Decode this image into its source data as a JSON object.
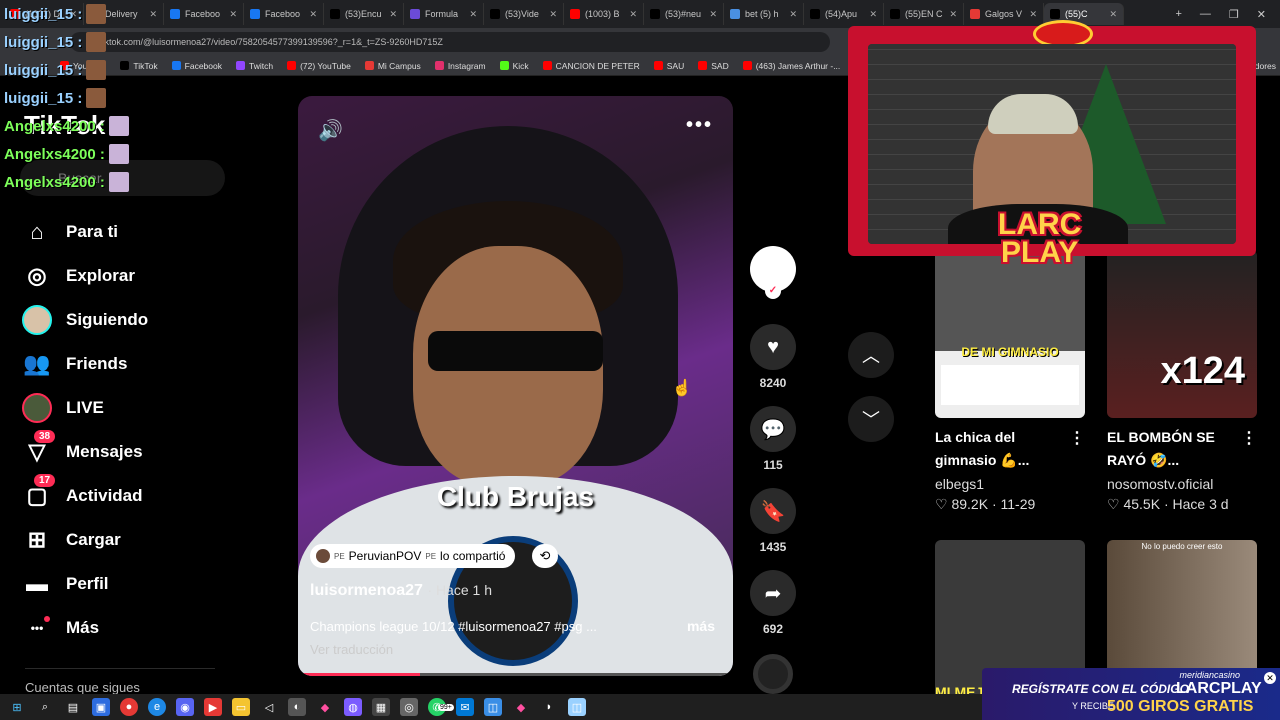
{
  "browser": {
    "tabs": [
      {
        "label": "(1003) D",
        "color": "#ff0000"
      },
      {
        "label": "Delivery",
        "color": "#3b82f6"
      },
      {
        "label": "Faceboo",
        "color": "#1877f2"
      },
      {
        "label": "Faceboo",
        "color": "#1877f2"
      },
      {
        "label": "(53)Encu",
        "color": "#000000"
      },
      {
        "label": "Formula",
        "color": "#6b4bd8"
      },
      {
        "label": "(53)Vide",
        "color": "#000000"
      },
      {
        "label": "(1003) B",
        "color": "#ff0000"
      },
      {
        "label": "(53)#neu",
        "color": "#000000"
      },
      {
        "label": "bet (5) h",
        "color": "#4a90e2"
      },
      {
        "label": "(54)Apu",
        "color": "#000000"
      },
      {
        "label": "(55)EN C",
        "color": "#000000"
      },
      {
        "label": "Galgos V",
        "color": "#e53935"
      },
      {
        "label": "(55)C",
        "color": "#000000"
      }
    ],
    "url": "tiktok.com/@luisormenoa27/video/7582054577399139596?_r=1&_t=ZS-9260HD715Z",
    "bookmarks": [
      {
        "label": "YouTube",
        "color": "#ff0000"
      },
      {
        "label": "TikTok",
        "color": "#000000"
      },
      {
        "label": "Facebook",
        "color": "#1877f2"
      },
      {
        "label": "Twitch",
        "color": "#9146ff"
      },
      {
        "label": "(72) YouTube",
        "color": "#ff0000"
      },
      {
        "label": "Mi Campus",
        "color": "#e53935"
      },
      {
        "label": "Instagram",
        "color": "#e1306c"
      },
      {
        "label": "Kick",
        "color": "#53fc18"
      },
      {
        "label": "CANCION DE PETER",
        "color": "#ff0000"
      },
      {
        "label": "SAU",
        "color": "#ff0000"
      },
      {
        "label": "SAD",
        "color": "#ff0000"
      },
      {
        "label": "(463) James Arthur -...",
        "color": "#ff0000"
      },
      {
        "label": "DRAGON BALL GT",
        "color": "#ff0000"
      }
    ],
    "bookmarks_overflow": "dores"
  },
  "chat": [
    {
      "user": "luiggii_15 :",
      "color_class": "u1"
    },
    {
      "user": "luiggii_15 :",
      "color_class": "u1"
    },
    {
      "user": "luiggii_15 :",
      "color_class": "u1"
    },
    {
      "user": "luiggii_15 :",
      "color_class": "u1"
    },
    {
      "user": "Angelxs4200 :",
      "color_class": "u2"
    },
    {
      "user": "Angelxs4200 :",
      "color_class": "u2"
    },
    {
      "user": "Angelxs4200 :",
      "color_class": "u2"
    }
  ],
  "sidebar": {
    "logo": "TikTok",
    "search_placeholder": "Buscar",
    "items": [
      {
        "label": "Para ti",
        "icon": "home-icon"
      },
      {
        "label": "Explorar",
        "icon": "compass-icon"
      },
      {
        "label": "Siguiendo",
        "icon": "following-avatar-icon"
      },
      {
        "label": "Friends",
        "icon": "friends-icon"
      },
      {
        "label": "LIVE",
        "icon": "live-avatar-icon"
      },
      {
        "label": "Mensajes",
        "icon": "messages-icon",
        "badge": "38"
      },
      {
        "label": "Actividad",
        "icon": "activity-icon",
        "badge": "17"
      },
      {
        "label": "Cargar",
        "icon": "upload-icon"
      },
      {
        "label": "Perfil",
        "icon": "profile-icon"
      },
      {
        "label": "Más",
        "icon": "more-icon"
      }
    ],
    "following_heading": "Cuentas que sigues"
  },
  "video": {
    "overlay_text": "Club Brujas",
    "shared_badge_prefix": "PE",
    "shared_by": "PeruvianPOV",
    "shared_by_prefix": "PE",
    "shared_suffix": "lo compartió",
    "author": "luisormenoa27",
    "time": "· Hace 1 h",
    "description": "Champions league 10/12 #luisormenoa27 #psg ...",
    "more_label": "más",
    "translate_label": "Ver traducción",
    "progress": 0.28
  },
  "actions": {
    "likes": "8240",
    "comments": "115",
    "saves": "1435",
    "shares": "692"
  },
  "stream": {
    "name_line1": "LARC",
    "name_line2": "PLAY"
  },
  "recommendations": [
    {
      "thumb_caption": "DE MI GIMNASIO",
      "title": "La chica del gimnasio 💪...",
      "author": "elbegs1",
      "likes": "89.2K",
      "date": "11-29"
    },
    {
      "thumb_caption": "x124",
      "title": "EL BOMBÓN SE RAYÓ 🤣...",
      "author": "nosomostv.oficial",
      "likes": "45.5K",
      "date": "Hace 3 d"
    },
    {
      "thumb_caption": "MI MEJOR AMIGO",
      "title": "",
      "author": "",
      "likes": "",
      "date": ""
    },
    {
      "thumb_caption": "No lo puedo creer esto",
      "title": "",
      "author": "",
      "likes": "",
      "date": ""
    }
  ],
  "ad": {
    "site": "meridiancasino",
    "line1": "REGÍSTRATE CON EL CÓDIGO",
    "code": "LARCPLAY",
    "line2": "Y RECIBE",
    "bonus": "500 GIROS GRATIS"
  },
  "taskbar": {
    "whatsapp_badge": "99+"
  }
}
